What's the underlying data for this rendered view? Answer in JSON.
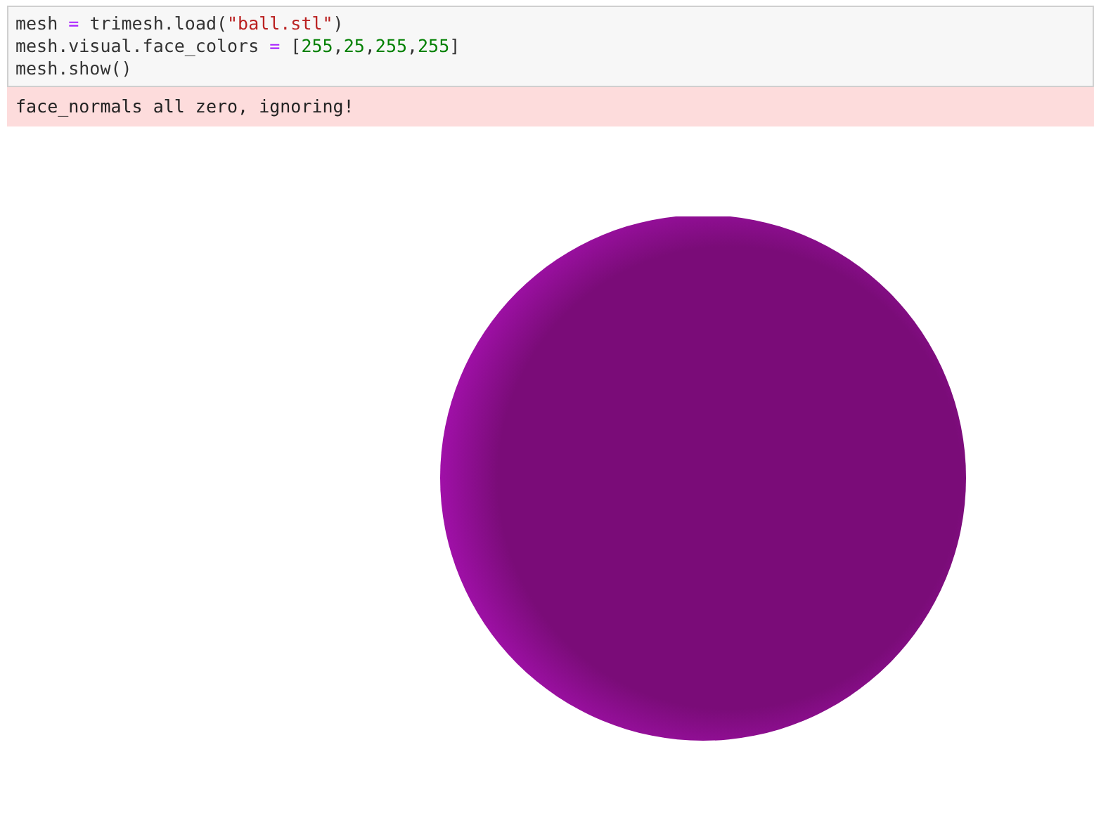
{
  "input_cell": {
    "lines": [
      [
        {
          "kind": "name",
          "text": "mesh "
        },
        {
          "kind": "op",
          "text": "="
        },
        {
          "kind": "name",
          "text": " trimesh.load("
        },
        {
          "kind": "string",
          "text": "\"ball.stl\""
        },
        {
          "kind": "name",
          "text": ")"
        }
      ],
      [
        {
          "kind": "name",
          "text": "mesh.visual.face_colors "
        },
        {
          "kind": "op",
          "text": "="
        },
        {
          "kind": "name",
          "text": " ["
        },
        {
          "kind": "number",
          "text": "255"
        },
        {
          "kind": "name",
          "text": ","
        },
        {
          "kind": "number",
          "text": "25"
        },
        {
          "kind": "name",
          "text": ","
        },
        {
          "kind": "number",
          "text": "255"
        },
        {
          "kind": "name",
          "text": ","
        },
        {
          "kind": "number",
          "text": "255"
        },
        {
          "kind": "name",
          "text": "]"
        }
      ],
      [
        {
          "kind": "name",
          "text": "mesh.show()"
        }
      ]
    ]
  },
  "stderr_output": {
    "text": "face_normals all zero, ignoring!"
  },
  "render_output": {
    "kind": "sphere",
    "color": "#7a0c78"
  }
}
